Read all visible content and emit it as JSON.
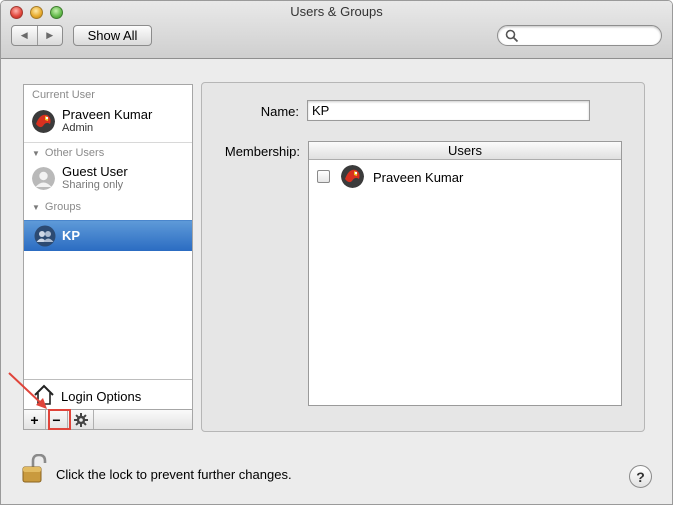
{
  "window": {
    "title": "Users & Groups",
    "back_glyph": "◀",
    "forward_glyph": "▶",
    "show_all_label": "Show All",
    "search_placeholder": ""
  },
  "sidebar": {
    "current_user_heading": "Current User",
    "current_user": {
      "name": "Praveen Kumar",
      "role": "Admin"
    },
    "other_users_heading": "Other Users",
    "other_users": [
      {
        "name": "Guest User",
        "role": "Sharing only"
      }
    ],
    "groups_heading": "Groups",
    "groups": [
      {
        "name": "KP",
        "selected": true
      }
    ],
    "login_options_label": "Login Options",
    "add_glyph": "+",
    "remove_glyph": "−",
    "action_icon": "gear-icon"
  },
  "detail": {
    "name_label": "Name:",
    "name_value": "KP",
    "membership_label": "Membership:",
    "table_header": "Users",
    "members": [
      {
        "name": "Praveen Kumar",
        "checked": false
      }
    ]
  },
  "footer": {
    "lock_text": "Click the lock to prevent further changes.",
    "help_glyph": "?"
  },
  "colors": {
    "selection": "#3a7bd5",
    "annotation": "#e0443a"
  }
}
